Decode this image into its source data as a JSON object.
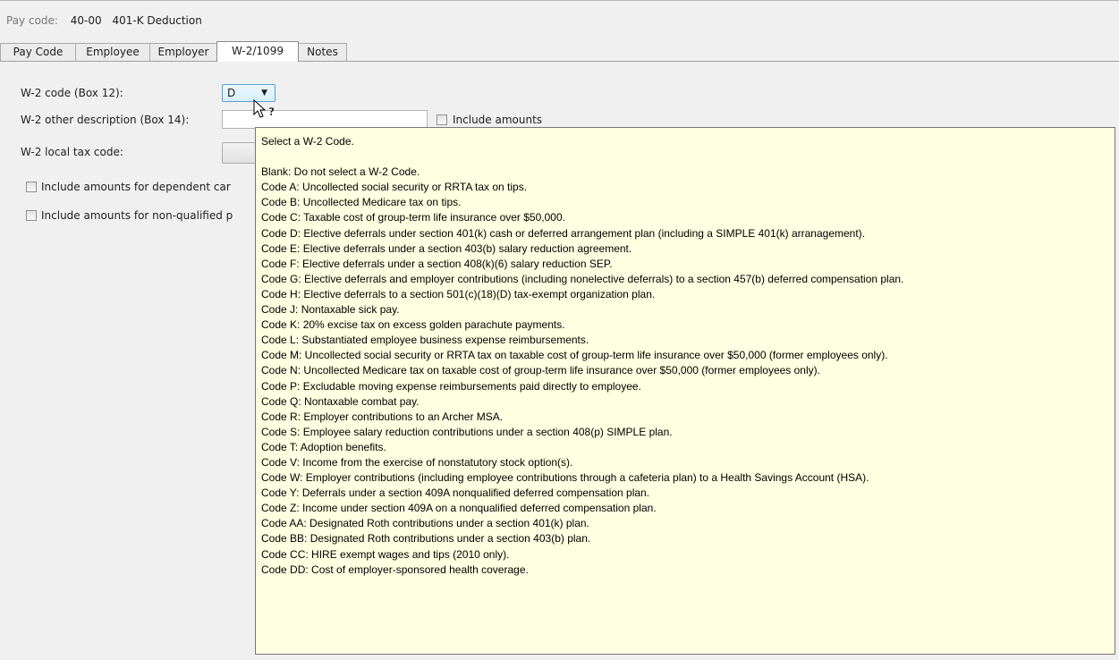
{
  "header": {
    "paycode_label": "Pay code:",
    "paycode_value": "40-00",
    "paycode_desc": "401-K Deduction"
  },
  "tabs": [
    {
      "label": "Pay Code",
      "active": false
    },
    {
      "label": "Employee",
      "active": false
    },
    {
      "label": "Employer",
      "active": false
    },
    {
      "label": "W-2/1099",
      "active": true
    },
    {
      "label": "Notes",
      "active": false
    }
  ],
  "form": {
    "w2_code_label": "W-2 code (Box 12):",
    "w2_code_value": "D",
    "w2_other_desc_label": "W-2 other description (Box 14):",
    "w2_other_desc_value": "",
    "include_amounts_label": "Include amounts",
    "w2_local_tax_label": "W-2 local tax code:",
    "dependent_care_label": "Include amounts for dependent car",
    "nonqualified_label": "Include amounts for non-qualified p"
  },
  "tooltip": {
    "title": "Select a W-2 Code.",
    "lines": [
      "Blank: Do not select a W-2 Code.",
      "Code A: Uncollected social security or RRTA tax on tips.",
      "Code B: Uncollected Medicare tax on tips.",
      "Code C: Taxable cost of group-term life insurance over $50,000.",
      "Code D: Elective deferrals under section 401(k) cash or deferred arrangement plan (including a SIMPLE 401(k) arranagement).",
      "Code E: Elective deferrals under a section 403(b) salary reduction agreement.",
      "Code F: Elective deferrals under a section 408(k)(6) salary reduction SEP.",
      "Code G: Elective deferrals and employer contributions (including nonelective deferrals) to a section 457(b) deferred compensation plan.",
      "Code H: Elective deferrals to a section 501(c)(18)(D) tax-exempt organization plan.",
      "Code J: Nontaxable sick pay.",
      "Code K: 20% excise tax on excess golden parachute payments.",
      "Code L: Substantiated employee business expense reimbursements.",
      "Code M: Uncollected social security or RRTA tax on taxable cost of group-term life insurance over $50,000 (former employees only).",
      "Code N: Uncollected Medicare tax on taxable cost of group-term life insurance over $50,000 (former employees only).",
      "Code P: Excludable moving expense reimbursements paid directly to employee.",
      "Code Q: Nontaxable combat pay.",
      "Code R: Employer contributions to an Archer MSA.",
      "Code S: Employee salary reduction contributions under a section 408(p) SIMPLE plan.",
      "Code T: Adoption benefits.",
      "Code V: Income from the exercise of nonstatutory stock option(s).",
      "Code W: Employer contributions (including employee contributions through a cafeteria plan) to a Health Savings Account (HSA).",
      "Code Y: Deferrals under a section 409A nonqualified deferred compensation plan.",
      "Code Z: Income under section 409A on a nonqualified deferred compensation plan.",
      "Code AA: Designated Roth contributions under a section 401(k) plan.",
      "Code BB: Designated Roth contributions under a section 403(b) plan.",
      "Code CC: HIRE exempt wages and tips (2010 only).",
      "Code DD: Cost of employer-sponsored health coverage."
    ]
  },
  "icons": {
    "cursor": "help-cursor-icon",
    "dropdown": "chevron-down-icon"
  }
}
